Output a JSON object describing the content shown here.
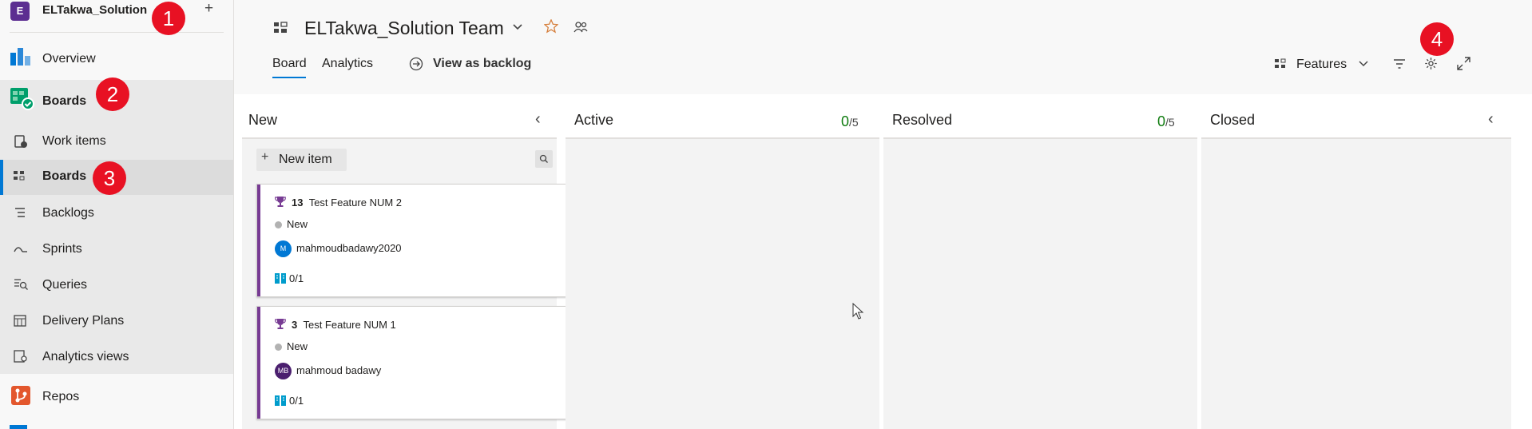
{
  "project": {
    "initial": "E",
    "name": "ELTakwa_Solution",
    "add": "+"
  },
  "nav": {
    "overview": "Overview",
    "boards_hub": "Boards",
    "work_items": "Work items",
    "boards": "Boards",
    "backlogs": "Backlogs",
    "sprints": "Sprints",
    "queries": "Queries",
    "delivery_plans": "Delivery Plans",
    "analytics_views": "Analytics views",
    "repos": "Repos"
  },
  "header": {
    "team": "ELTakwa_Solution Team",
    "tabs": [
      "Board",
      "Analytics"
    ],
    "view_as_backlog": "View as backlog",
    "backlog_level": "Features"
  },
  "columns": [
    {
      "title": "New"
    },
    {
      "title": "Active",
      "count": "0",
      "limit": "/5"
    },
    {
      "title": "Resolved",
      "count": "0",
      "limit": "/5"
    },
    {
      "title": "Closed"
    }
  ],
  "new_item_label": "New item",
  "cards": [
    {
      "id": "13",
      "title": "Test Feature NUM 2",
      "state": "New",
      "assignee": "mahmoudbadawy2020",
      "avatar": "M",
      "avatar_color": "#0078d4",
      "progress": "0/1"
    },
    {
      "id": "3",
      "title": "Test Feature NUM 1",
      "state": "New",
      "assignee": "mahmoud badawy",
      "avatar": "MB",
      "avatar_color": "#4b1f6f",
      "progress": "0/1"
    }
  ],
  "markers": [
    "1",
    "2",
    "3",
    "4"
  ],
  "colors": {
    "accent": "#0078d4",
    "feature": "#773b93",
    "marker": "#e81123",
    "count": "#107c10"
  }
}
